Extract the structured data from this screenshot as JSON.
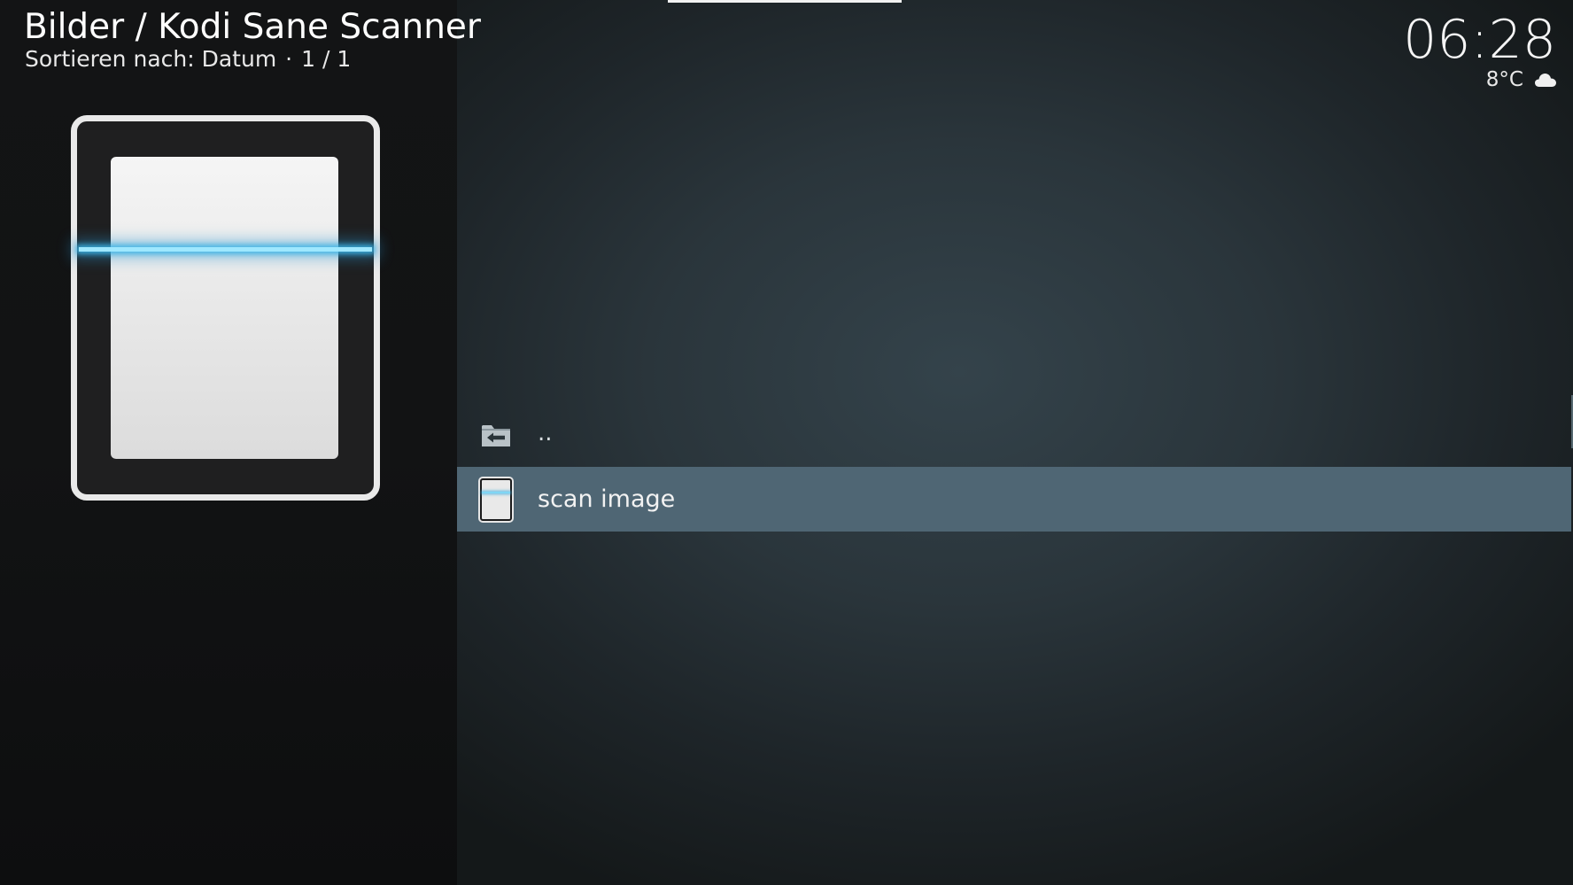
{
  "header": {
    "title": "Bilder / Kodi Sane Scanner",
    "sort_label": "Sortieren nach: Datum",
    "separator": "·",
    "page_info": "1 / 1"
  },
  "status": {
    "time": "06:28",
    "temperature": "8°C",
    "weather_icon": "cloud-icon"
  },
  "thumbnail": {
    "icon": "scanner-icon"
  },
  "list": {
    "items": [
      {
        "label": "..",
        "icon": "folder-back-icon",
        "selected": false
      },
      {
        "label": "scan image",
        "icon": "scanner-icon",
        "selected": true
      }
    ]
  },
  "colors": {
    "selection": "#4f6674",
    "scan_beam": "#9fe8ff"
  }
}
